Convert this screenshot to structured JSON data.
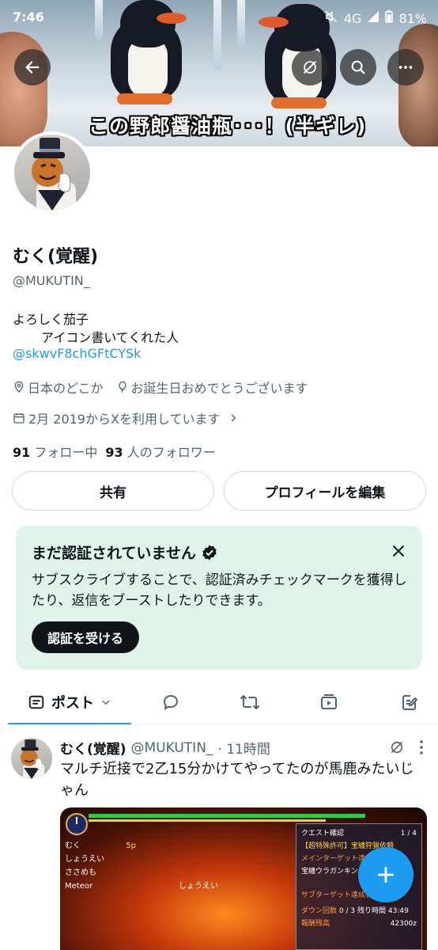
{
  "status_bar": {
    "time": "7:46",
    "network": "4G",
    "battery": "81%"
  },
  "banner": {
    "subtitle": "この野郎醤油瓶･･･！(半ギレ)"
  },
  "profile": {
    "name": "むく(覚醒)",
    "handle": "@MUKUTIN_",
    "bio_line1": "よろしく茄子",
    "bio_line2": "アイコン書いてくれた人",
    "bio_link": "@skwvF8chGFtCYSk",
    "location": "日本のどこか",
    "birthday": "お誕生日おめでとうございます",
    "joined": "2月 2019からXを利用しています",
    "following_count": "91",
    "following_label": "フォロー中",
    "followers_count": "93",
    "followers_label": "人のフォロワー"
  },
  "buttons": {
    "share": "共有",
    "edit_profile": "プロフィールを編集"
  },
  "verify_card": {
    "title": "まだ認証されていません",
    "description": "サブスクライブすることで、認証済みチェックマークを獲得したり、返信をブーストしたりできます。",
    "cta": "認証を受ける"
  },
  "tabs": {
    "posts": "ポスト"
  },
  "post": {
    "name": "むく(覚醒)",
    "handle": "@MUKUTIN_",
    "time": "· 11時間",
    "text": "マルチ近接で2乙15分かけてやってたのが馬鹿みたいじゃん",
    "media": {
      "players": [
        "むく",
        "しょうえい",
        "ささめも",
        "Meteor"
      ],
      "level": "5p",
      "quest_title": "クエスト確認",
      "page": "1 / 4",
      "quest_sub": "【超特殊許可】宝纏狩猟依頼",
      "main_target_label": "メインターゲット達成状況",
      "main_target": "宝纏ウラガンキン",
      "sub_target_label": "サブターゲット達成状況",
      "down_label": "ダウン回数",
      "down_value": "0 / 3",
      "time_label": "残り時間",
      "time_value": "43:49",
      "reward_label": "報酬残高",
      "reward_value": "42300z",
      "monster_label": "しょうえい"
    }
  },
  "colors": {
    "accent": "#1d9bf0",
    "verify_bg": "#dff3eb",
    "text": "#0f1419",
    "muted": "#536471"
  }
}
